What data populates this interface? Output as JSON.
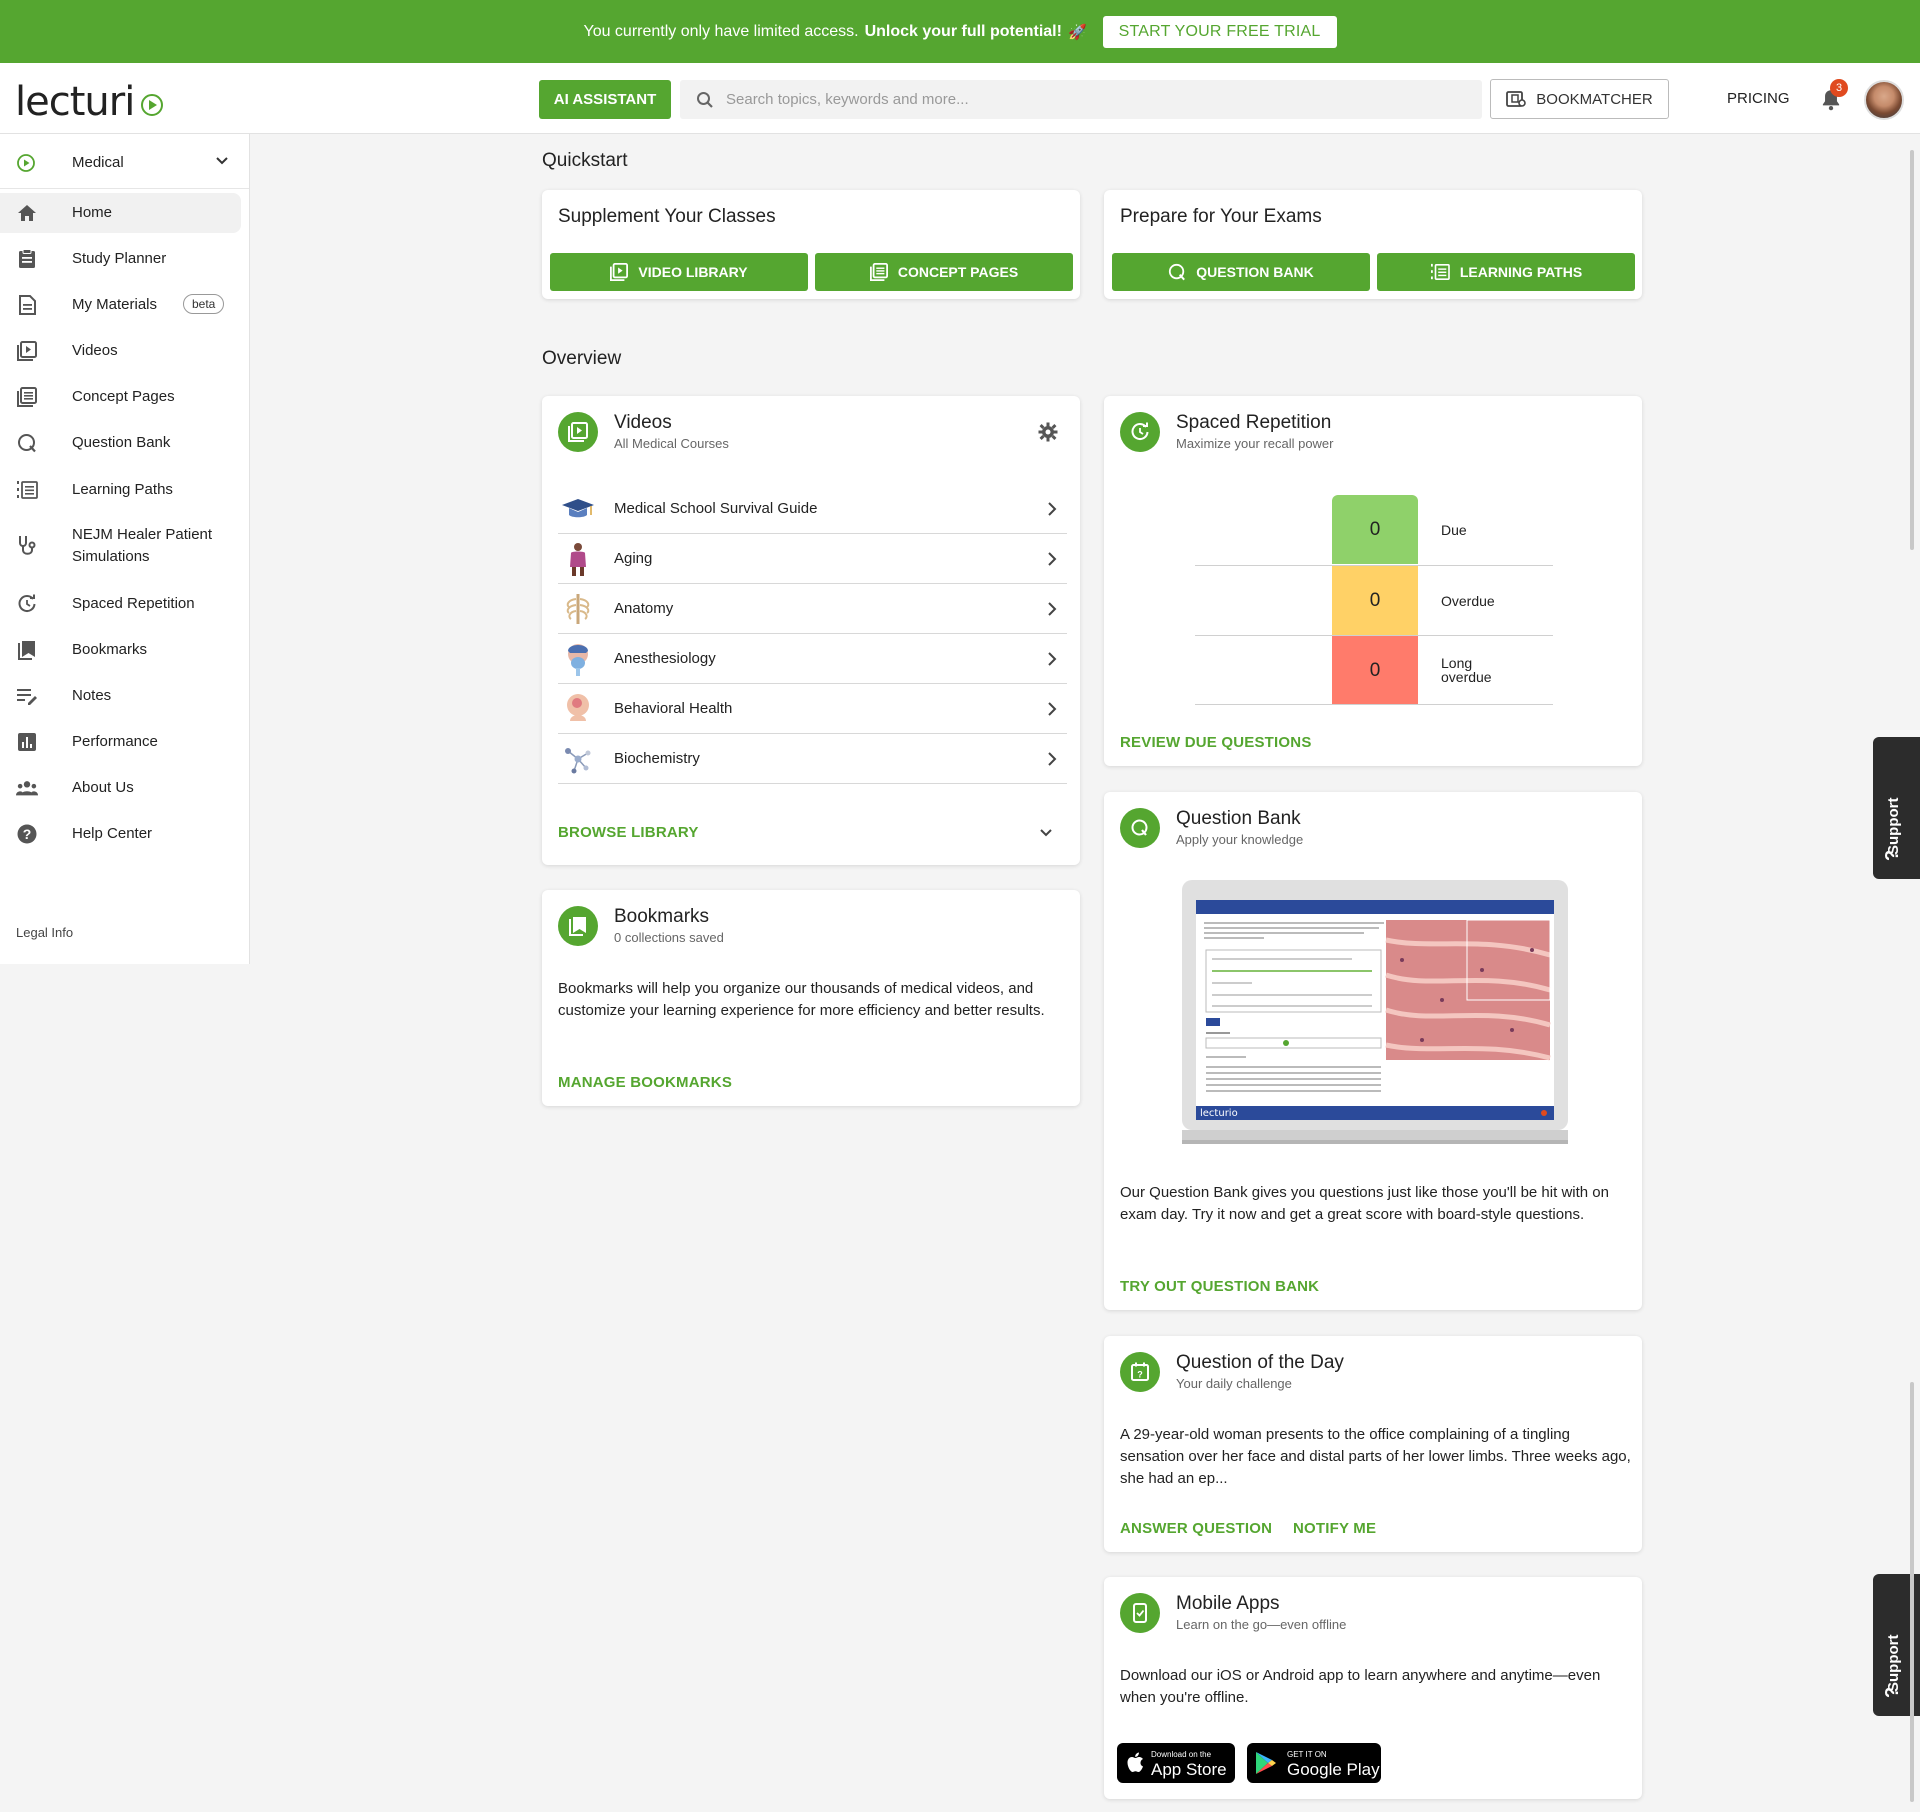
{
  "banner": {
    "text": "You currently only have limited access.",
    "bold": "Unlock your full potential!",
    "cta": "START YOUR FREE TRIAL"
  },
  "header": {
    "logo": "lecturio",
    "ai_assistant": "AI ASSISTANT",
    "search_placeholder": "Search topics, keywords and more...",
    "bookmatcher": "BOOKMATCHER",
    "pricing": "PRICING",
    "notification_count": "3"
  },
  "sidebar": {
    "course": "Medical",
    "items": [
      {
        "label": "Home",
        "icon": "home-icon"
      },
      {
        "label": "Study Planner",
        "icon": "clipboard-icon"
      },
      {
        "label": "My Materials",
        "icon": "document-icon",
        "badge": "beta"
      },
      {
        "label": "Videos",
        "icon": "video-icon"
      },
      {
        "label": "Concept Pages",
        "icon": "concept-page-icon"
      },
      {
        "label": "Question Bank",
        "icon": "question-bank-icon"
      },
      {
        "label": "Learning Paths",
        "icon": "learning-path-icon"
      },
      {
        "label": "NEJM Healer Patient",
        "label2": "Simulations",
        "icon": "stethoscope-icon"
      },
      {
        "label": "Spaced Repetition",
        "icon": "spaced-repetition-icon"
      },
      {
        "label": "Bookmarks",
        "icon": "bookmark-icon"
      },
      {
        "label": "Notes",
        "icon": "notes-icon"
      },
      {
        "label": "Performance",
        "icon": "chart-icon"
      },
      {
        "label": "About Us",
        "icon": "people-icon"
      },
      {
        "label": "Help Center",
        "icon": "help-icon"
      }
    ],
    "legal": "Legal Info"
  },
  "quickstart": {
    "title": "Quickstart",
    "classes": {
      "title": "Supplement Your Classes",
      "btn1": "VIDEO LIBRARY",
      "btn2": "CONCEPT PAGES"
    },
    "exams": {
      "title": "Prepare for Your Exams",
      "btn1": "QUESTION BANK",
      "btn2": "LEARNING PATHS"
    }
  },
  "overview": {
    "title": "Overview",
    "videos": {
      "title": "Videos",
      "subtitle": "All Medical Courses",
      "rows": [
        "Medical School Survival Guide",
        "Aging",
        "Anatomy",
        "Anesthesiology",
        "Behavioral Health",
        "Biochemistry"
      ],
      "browse": "BROWSE LIBRARY"
    },
    "bookmarks": {
      "title": "Bookmarks",
      "subtitle": "0 collections saved",
      "body": "Bookmarks will help you organize our thousands of medical videos, and customize your learning experience for more efficiency and better results.",
      "link": "MANAGE BOOKMARKS"
    },
    "spaced": {
      "title": "Spaced Repetition",
      "subtitle": "Maximize your recall power",
      "rows": [
        {
          "value": "0",
          "label": "Due",
          "color": "#8fd16a"
        },
        {
          "value": "0",
          "label": "Overdue",
          "color": "#ffd166"
        },
        {
          "value": "0",
          "label": "Long",
          "label2": "overdue",
          "color": "#ff7b6b"
        }
      ],
      "link": "REVIEW DUE QUESTIONS"
    },
    "qbank": {
      "title": "Question Bank",
      "subtitle": "Apply your knowledge",
      "body": "Our Question Bank gives you questions just like those you'll be hit with on exam day. Try it now and get a great score with board-style questions.",
      "link": "TRY OUT QUESTION BANK"
    },
    "qotd": {
      "title": "Question of the Day",
      "subtitle": "Your daily challenge",
      "body": "A 29-year-old woman presents to the office complaining of a tingling sensation over her face and distal parts of her lower limbs. Three weeks ago, she had an ep...",
      "link1": "ANSWER QUESTION",
      "link2": "NOTIFY ME"
    },
    "mobile": {
      "title": "Mobile Apps",
      "subtitle": "Learn on the go—even offline",
      "body": "Download our iOS or Android app to learn anywhere and anytime—even when you're offline.",
      "appstore_small": "Download on the",
      "appstore_big": "App Store",
      "play_small": "GET IT ON",
      "play_big": "Google Play"
    }
  },
  "support": "Support",
  "accent": "#55a630"
}
